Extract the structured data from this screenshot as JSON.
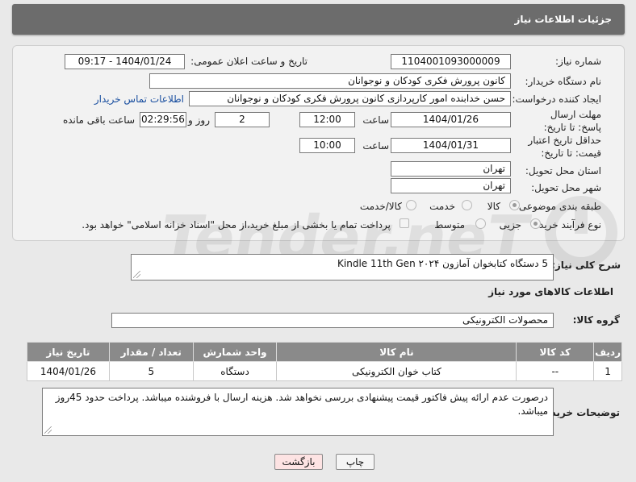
{
  "header": {
    "title": "جزئیات اطلاعات نیاز"
  },
  "form": {
    "need_number_label": "شماره نیاز:",
    "need_number": "1104001093000009",
    "announce_label": "تاریخ و ساعت اعلان عمومی:",
    "announce_value": "1404/01/24 - 09:17",
    "buyer_label": "نام دستگاه خریدار:",
    "buyer_value": "کانون پرورش فکری کودکان و نوجوانان",
    "creator_label": "ایجاد کننده درخواست:",
    "creator_value": "حسن خدابنده امور کارپردازی  کانون پرورش فکری کودکان و نوجوانان",
    "contact_link": "اطلاعات تماس خریدار",
    "reply_deadline_label": "مهلت ارسال پاسخ: تا تاریخ:",
    "reply_date": "1404/01/26",
    "time_label": "ساعت",
    "reply_time": "12:00",
    "days_value": "2",
    "days_label": "روز و",
    "remaining_time": "02:29:56",
    "remaining_label": "ساعت باقی مانده",
    "price_validity_label": "حداقل تاریخ اعتبار قیمت: تا تاریخ:",
    "price_date": "1404/01/31",
    "price_time": "10:00",
    "province_label": "استان محل تحویل:",
    "province_value": "تهران",
    "city_label": "شهر محل تحویل:",
    "city_value": "تهران",
    "category_label": "طبقه بندی موضوعی:",
    "category_options": [
      "کالا",
      "خدمت",
      "کالا/خدمت"
    ],
    "category_selected": "کالا",
    "process_label": "نوع فرآیند خرید :",
    "process_options": [
      "جزیی",
      "متوسط"
    ],
    "process_selected": "جزیی",
    "payment_note": "پرداخت تمام یا بخشی از مبلغ خرید،از محل \"اسناد خزانه اسلامی\" خواهد بود."
  },
  "watermark": {
    "text": "AriaTender.neT"
  },
  "description": {
    "label": "شرح کلی نیاز:",
    "value": "5 دستگاه کتابخوان آمازون Kindle 11th Gen ۲۰۲۴"
  },
  "goods": {
    "section_title": "اطلاعات کالاهای مورد نیاز",
    "group_label": "گروه کالا:",
    "group_value": "محصولات الکترونیکی",
    "columns": [
      "ردیف",
      "کد کالا",
      "نام کالا",
      "واحد شمارش",
      "تعداد / مقدار",
      "تاریخ نیاز"
    ],
    "rows": [
      [
        "1",
        "--",
        "کتاب خوان الکترونیکی",
        "دستگاه",
        "5",
        "1404/01/26"
      ]
    ]
  },
  "notes": {
    "label": "توضیحات خریدار:",
    "value": "درصورت عدم ارائه پیش فاکتور قیمت پیشنهادی بررسی نخواهد شد. هزینه ارسال با فروشنده میباشد. پرداخت حدود 45روز میباشد."
  },
  "buttons": {
    "print": "چاپ",
    "back": "بازگشت"
  },
  "colors": {
    "header_bg": "#6c6c6c",
    "table_header_bg": "#8a8a8a",
    "back_button_bg": "#fde3e3",
    "link": "#1a4fa0"
  }
}
